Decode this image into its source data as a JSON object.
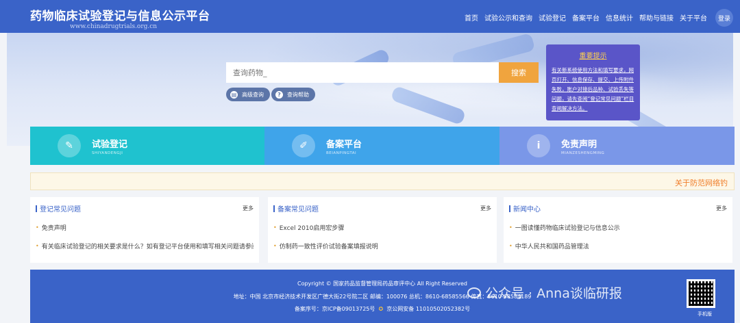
{
  "header": {
    "title": "药物临床试验登记与信息公示平台",
    "url": "www.chinadrugtrials.org.cn",
    "nav": [
      "首页",
      "试验公示和查询",
      "试验登记",
      "备案平台",
      "信息统计",
      "帮助与链接",
      "关于平台"
    ],
    "login": "登录"
  },
  "search": {
    "placeholder": "查询药物_",
    "button": "搜索",
    "advanced": "高级查询",
    "help": "查询帮助"
  },
  "notice": {
    "title": "重要提示",
    "body": "有关新系统使用方法和填写要求，网页打开、信息保存、提交、上传附件失败，账户对接后品种、试验丢失等问题，请先查阅“登记常见问题”栏目查阅解决方法。"
  },
  "tiles": [
    {
      "title": "试验登记",
      "sub": "SHIYANDENGJI",
      "icon": "document-icon",
      "color": "#1fc2cf"
    },
    {
      "title": "备案平台",
      "sub": "BEIANPINGTAI",
      "icon": "edit-icon",
      "color": "#3fa4ea"
    },
    {
      "title": "免责声明",
      "sub": "MIANZESHENGMING",
      "icon": "info-icon",
      "color": "#7a97e8"
    }
  ],
  "marquee": "关于防范网络钓",
  "panels": [
    {
      "title": "登记常见问题",
      "more": "更多",
      "items": [
        "免责声明",
        "有关临床试验登记的相关要求是什么？如有登记平台使用和填写相关问题请参阅"
      ]
    },
    {
      "title": "备案常见问题",
      "more": "更多",
      "items": [
        "Excel 2010启用宏步骤",
        "仿制药一致性评价试验备案填报说明"
      ]
    },
    {
      "title": "新闻中心",
      "more": "更多",
      "items": [
        "一图读懂药物临床试验登记与信息公示",
        "中华人民共和国药品管理法"
      ]
    }
  ],
  "footer": {
    "copyright": "Copyright © 国家药品监督管理局药品审评中心 All Right Reserved",
    "address": "地址：中国 北京市经济技术开发区广德大街22号院二区 邮编：100076 总机：8610-68585566 传真：8610-68584189",
    "record": "备案序号：京ICP备09013725号",
    "police": "京公网安备 11010502052382号",
    "mobile": "手机版"
  },
  "watermark": "公众号 · Anna谈临研报"
}
